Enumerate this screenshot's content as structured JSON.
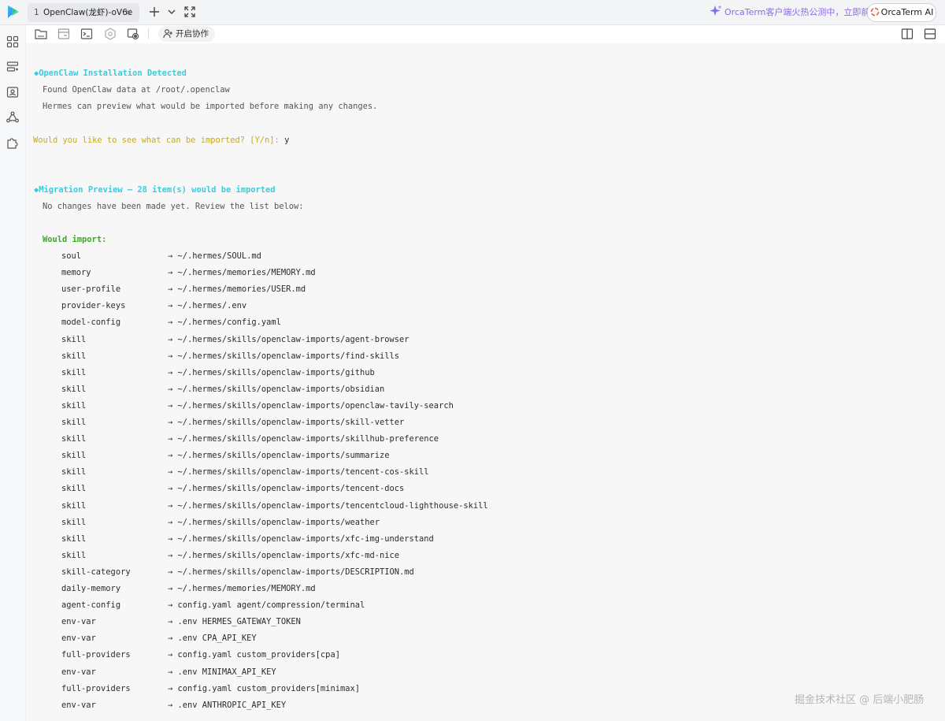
{
  "titlebar": {
    "tab_index": "1",
    "tab_title": "OpenClaw(龙虾)-oV6e",
    "tab_close_glyph": "✕",
    "promo_text": "OrcaTerm客户端火热公测中，立即前往",
    "ai_button_label": "OrcaTerm AI"
  },
  "toolbar": {
    "collab_label": "开启协作"
  },
  "terminal": {
    "detected_header": "◆OpenClaw Installation Detected",
    "found_line": "Found OpenClaw data at /root/.openclaw",
    "preview_line": "Hermes can preview what would be imported before making any changes.",
    "prompt": "Would you like to see what can be imported? [Y/n]:",
    "prompt_answer": "y",
    "migration_header": "◆Migration Preview — 28 item(s) would be imported",
    "no_changes": "No changes have been made yet. Review the list below:",
    "would_import": "Would import:",
    "items": [
      {
        "name": "soul",
        "target": "→ ~/.hermes/SOUL.md"
      },
      {
        "name": "memory",
        "target": "→ ~/.hermes/memories/MEMORY.md"
      },
      {
        "name": "user-profile",
        "target": "→ ~/.hermes/memories/USER.md"
      },
      {
        "name": "provider-keys",
        "target": "→ ~/.hermes/.env"
      },
      {
        "name": "model-config",
        "target": "→ ~/.hermes/config.yaml"
      },
      {
        "name": "skill",
        "target": "→ ~/.hermes/skills/openclaw-imports/agent-browser"
      },
      {
        "name": "skill",
        "target": "→ ~/.hermes/skills/openclaw-imports/find-skills"
      },
      {
        "name": "skill",
        "target": "→ ~/.hermes/skills/openclaw-imports/github"
      },
      {
        "name": "skill",
        "target": "→ ~/.hermes/skills/openclaw-imports/obsidian"
      },
      {
        "name": "skill",
        "target": "→ ~/.hermes/skills/openclaw-imports/openclaw-tavily-search"
      },
      {
        "name": "skill",
        "target": "→ ~/.hermes/skills/openclaw-imports/skill-vetter"
      },
      {
        "name": "skill",
        "target": "→ ~/.hermes/skills/openclaw-imports/skillhub-preference"
      },
      {
        "name": "skill",
        "target": "→ ~/.hermes/skills/openclaw-imports/summarize"
      },
      {
        "name": "skill",
        "target": "→ ~/.hermes/skills/openclaw-imports/tencent-cos-skill"
      },
      {
        "name": "skill",
        "target": "→ ~/.hermes/skills/openclaw-imports/tencent-docs"
      },
      {
        "name": "skill",
        "target": "→ ~/.hermes/skills/openclaw-imports/tencentcloud-lighthouse-skill"
      },
      {
        "name": "skill",
        "target": "→ ~/.hermes/skills/openclaw-imports/weather"
      },
      {
        "name": "skill",
        "target": "→ ~/.hermes/skills/openclaw-imports/xfc-img-understand"
      },
      {
        "name": "skill",
        "target": "→ ~/.hermes/skills/openclaw-imports/xfc-md-nice"
      },
      {
        "name": "skill-category",
        "target": "→ ~/.hermes/skills/openclaw-imports/DESCRIPTION.md"
      },
      {
        "name": "daily-memory",
        "target": "→ ~/.hermes/memories/MEMORY.md"
      },
      {
        "name": "agent-config",
        "target": "→ config.yaml agent/compression/terminal"
      },
      {
        "name": "env-var",
        "target": "→ .env HERMES_GATEWAY_TOKEN"
      },
      {
        "name": "env-var",
        "target": "→ .env CPA_API_KEY"
      },
      {
        "name": "full-providers",
        "target": "→ config.yaml custom_providers[cpa]"
      },
      {
        "name": "env-var",
        "target": "→ .env MINIMAX_API_KEY"
      },
      {
        "name": "full-providers",
        "target": "→ config.yaml custom_providers[minimax]"
      },
      {
        "name": "env-var",
        "target": "→ .env ANTHROPIC_API_KEY"
      }
    ]
  },
  "watermark": "掘金技术社区 @ 后端小肥肠",
  "colors": {
    "accent_cyan": "#3fcad9",
    "prompt_yellow": "#c5ac17",
    "heading_green": "#3aaa1f",
    "promo_purple": "#8b6ae8"
  },
  "icons": {
    "rail": [
      "dashboard-icon",
      "server-list-icon",
      "terminal-panel-icon",
      "network-icon",
      "plugin-icon"
    ],
    "toolbar": [
      "sftp-folder-icon",
      "file-manager-icon",
      "terminal-icon",
      "gear-icon",
      "screen-record-icon",
      "collab-user-icon"
    ],
    "titlebar": [
      "add-tab-icon",
      "chevron-down-icon",
      "fullscreen-icon",
      "sparkle-icon",
      "split-vertical-icon",
      "split-horizontal-icon"
    ]
  }
}
